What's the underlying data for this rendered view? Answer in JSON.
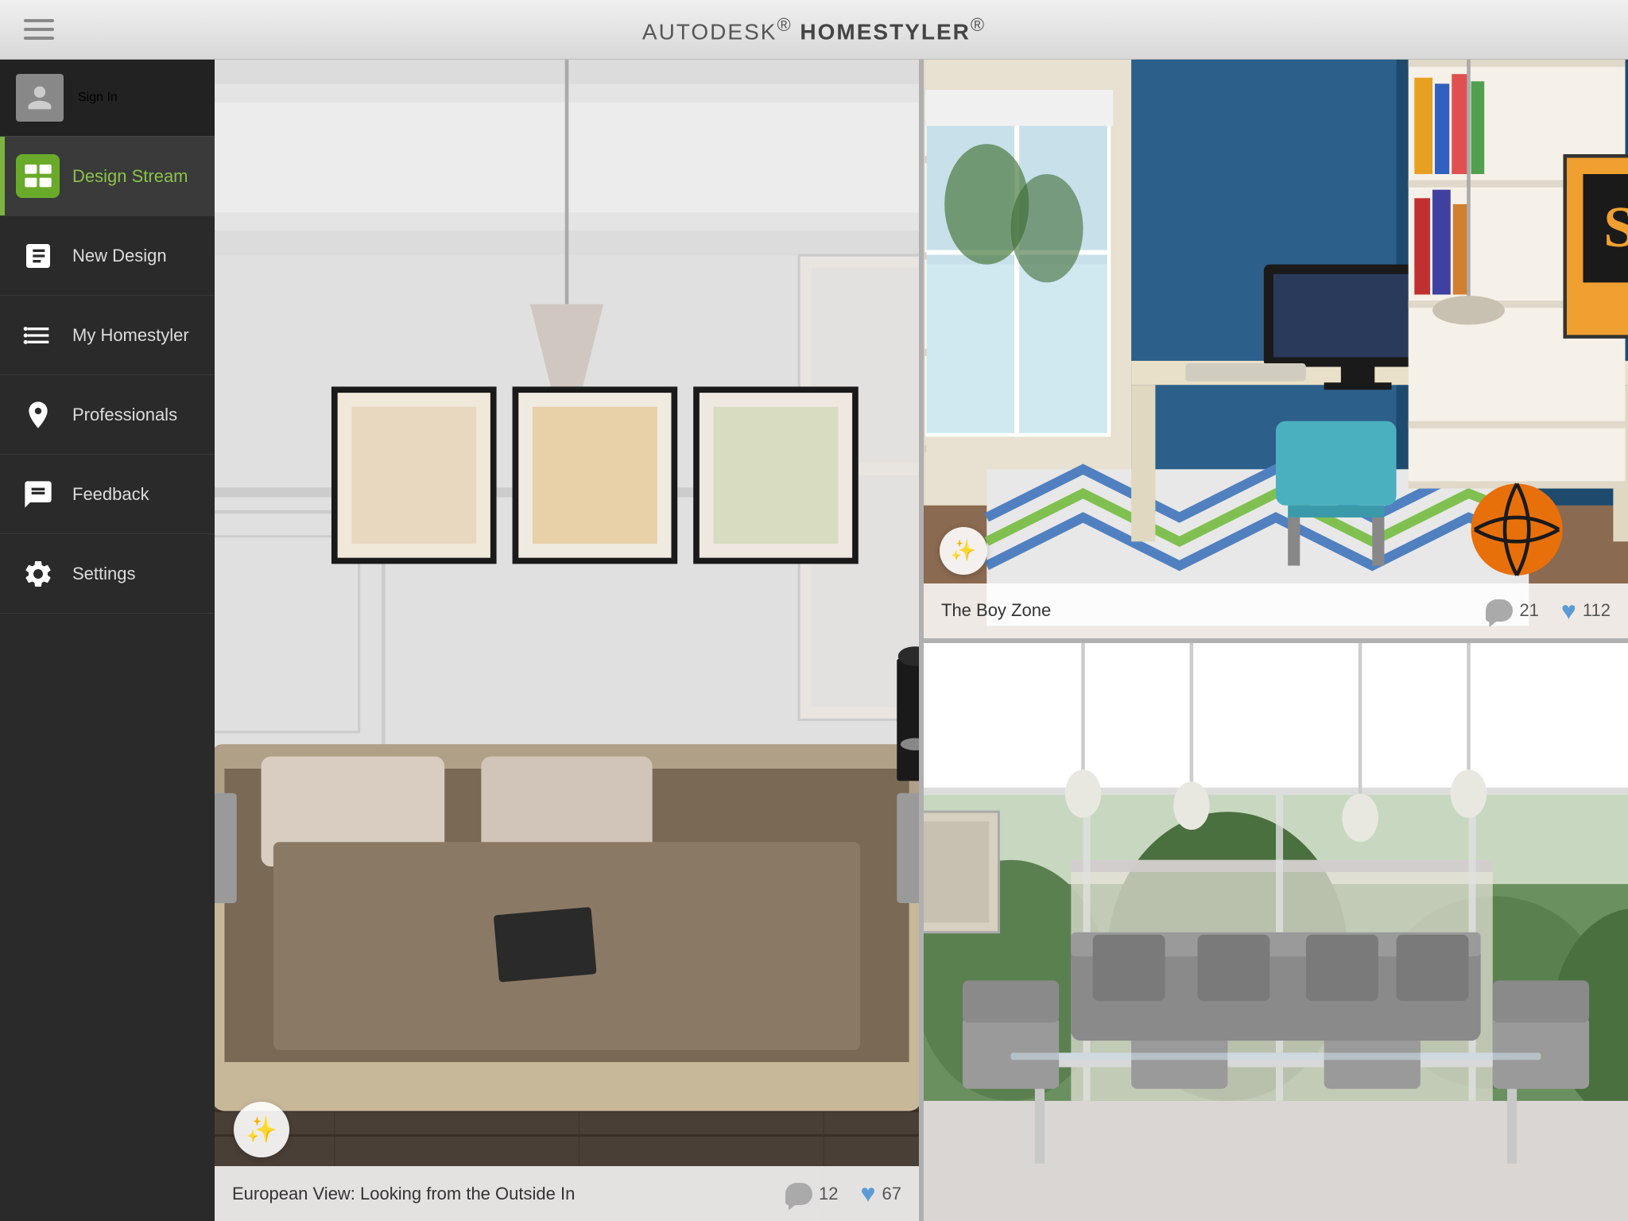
{
  "header": {
    "title_prefix": "AUTODESK",
    "title_suffix": "HOMESTYLER",
    "title_trademark": "®",
    "menu_icon_label": "menu"
  },
  "sidebar": {
    "sign_in_label": "Sign In",
    "items": [
      {
        "id": "design-stream",
        "label": "Design Stream",
        "active": true
      },
      {
        "id": "new-design",
        "label": "New Design",
        "active": false
      },
      {
        "id": "my-homestyler",
        "label": "My Homestyler",
        "active": false
      },
      {
        "id": "professionals",
        "label": "Professionals",
        "active": false
      },
      {
        "id": "feedback",
        "label": "Feedback",
        "active": false
      },
      {
        "id": "settings",
        "label": "Settings",
        "active": false
      }
    ]
  },
  "cards": {
    "large": {
      "title": "European View: Looking from the Outside In",
      "comments": "12",
      "likes": "67"
    },
    "top_right": {
      "title": "The Boy Zone",
      "comments": "21",
      "likes": "112"
    },
    "bottom_right": {
      "title": "",
      "comments": "",
      "likes": ""
    }
  }
}
